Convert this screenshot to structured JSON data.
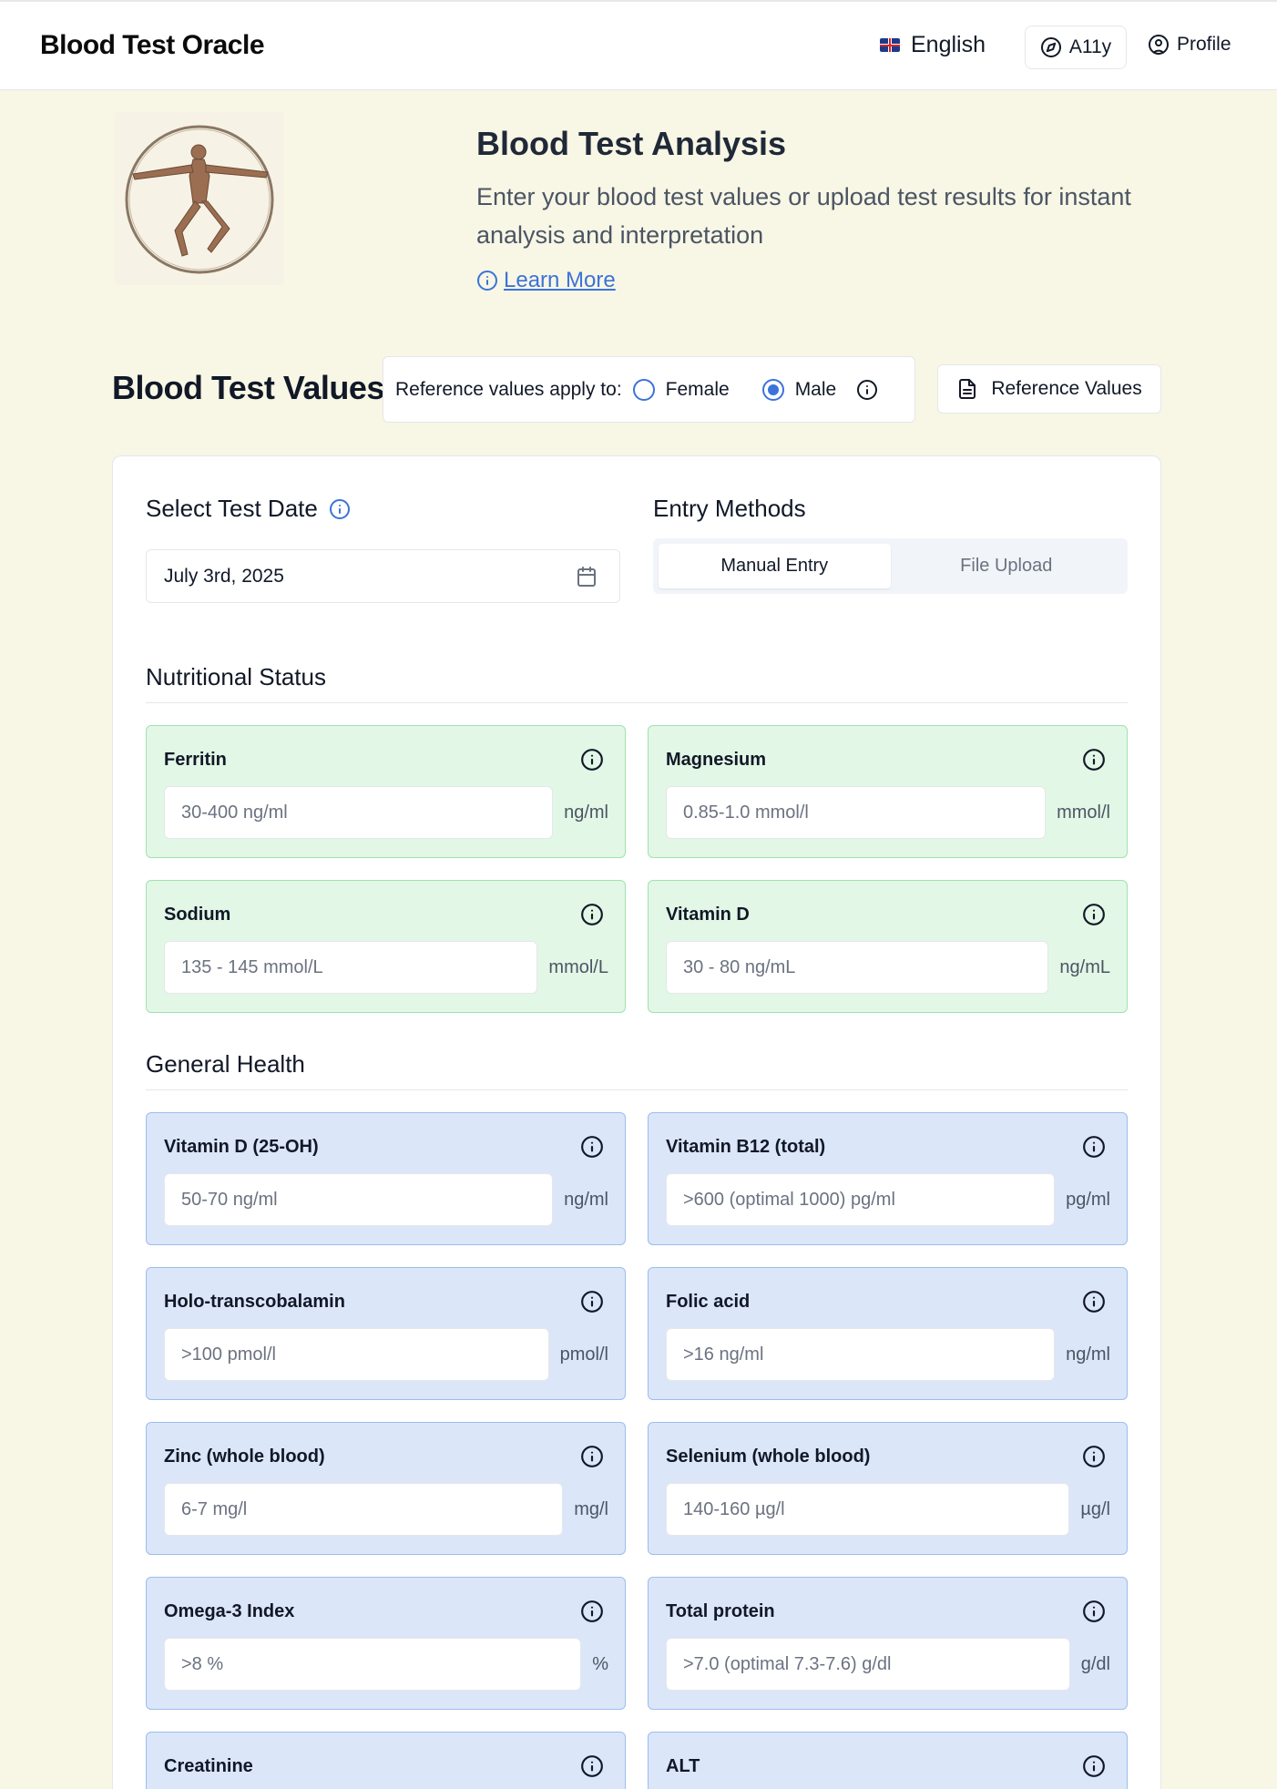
{
  "header": {
    "brand": "Blood Test Oracle",
    "language": "English",
    "a11y_label": "A11y",
    "profile_label": "Profile"
  },
  "hero": {
    "title": "Blood Test Analysis",
    "subtitle": "Enter your blood test values or upload test results for instant analysis and interpretation",
    "learn_more": "Learn More"
  },
  "values_section": {
    "title": "Blood Test Values",
    "reference_label": "Reference values apply to:",
    "female_label": "Female",
    "male_label": "Male",
    "selected_sex": "Male",
    "reference_button": "Reference Values"
  },
  "test_date": {
    "title": "Select Test Date",
    "value": "July 3rd, 2025"
  },
  "entry_methods": {
    "title": "Entry Methods",
    "tabs": [
      "Manual Entry",
      "File Upload"
    ],
    "active": "Manual Entry"
  },
  "groups": {
    "nutritional": {
      "title": "Nutritional Status",
      "tests": [
        {
          "name": "Ferritin",
          "placeholder": "30-400 ng/ml",
          "unit": "ng/ml"
        },
        {
          "name": "Magnesium",
          "placeholder": "0.85-1.0 mmol/l",
          "unit": "mmol/l"
        },
        {
          "name": "Sodium",
          "placeholder": "135 - 145 mmol/L",
          "unit": "mmol/L"
        },
        {
          "name": "Vitamin D",
          "placeholder": "30 - 80 ng/mL",
          "unit": "ng/mL"
        }
      ]
    },
    "general": {
      "title": "General Health",
      "tests": [
        {
          "name": "Vitamin D (25-OH)",
          "placeholder": "50-70 ng/ml",
          "unit": "ng/ml"
        },
        {
          "name": "Vitamin B12 (total)",
          "placeholder": ">600 (optimal 1000) pg/ml",
          "unit": "pg/ml"
        },
        {
          "name": "Holo-transcobalamin",
          "placeholder": ">100 pmol/l",
          "unit": "pmol/l"
        },
        {
          "name": "Folic acid",
          "placeholder": ">16 ng/ml",
          "unit": "ng/ml"
        },
        {
          "name": "Zinc (whole blood)",
          "placeholder": "6-7 mg/l",
          "unit": "mg/l"
        },
        {
          "name": "Selenium (whole blood)",
          "placeholder": "140-160 µg/l",
          "unit": "µg/l"
        },
        {
          "name": "Omega-3 Index",
          "placeholder": ">8 %",
          "unit": "%"
        },
        {
          "name": "Total protein",
          "placeholder": ">7.0 (optimal 7.3-7.6) g/dl",
          "unit": "g/dl"
        },
        {
          "name": "Creatinine",
          "placeholder": "",
          "unit": ""
        },
        {
          "name": "ALT",
          "placeholder": "",
          "unit": ""
        }
      ]
    }
  },
  "colors": {
    "accent": "#3b73d9",
    "nutritional_bg": "#e2f7e6",
    "general_bg": "#dce6f9",
    "page_bg": "#f8f6e5"
  }
}
